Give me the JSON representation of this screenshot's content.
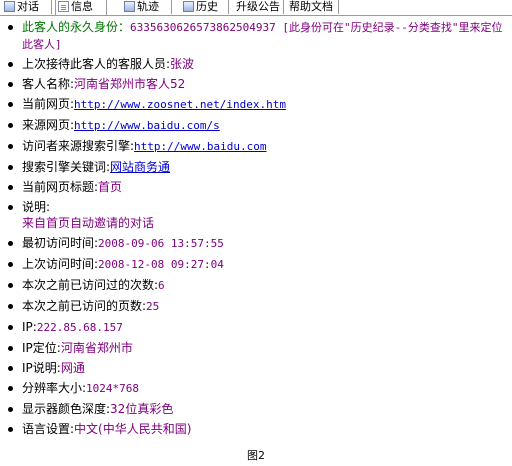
{
  "tabs": [
    {
      "label": "对话",
      "icon": "chat-icon"
    },
    {
      "label": "信息",
      "icon": "info-icon"
    },
    {
      "label": "轨迹",
      "icon": "track-icon"
    },
    {
      "label": "历史",
      "icon": "history-icon"
    },
    {
      "label": "升级公告",
      "icon": ""
    },
    {
      "label": "帮助文档",
      "icon": ""
    }
  ],
  "info": {
    "identity_label": "此客人的永久身份：",
    "identity_value": "633563062657386250493​7 [此身份可在\"历史纪录--分类查找\"里来定位此客人]",
    "last_agent_label": "上次接待此客人的客服人员:",
    "last_agent_value": "张波",
    "guest_name_label": "客人名称:",
    "guest_name_value": "河南省郑州市客人52",
    "current_page_label": "当前网页:",
    "current_page_value": "http://www.zoosnet.net/index.htm",
    "source_page_label": "来源网页:",
    "source_page_value": "http://www.baidu.com/s",
    "search_engine_label": "访问者来源搜索引擎:",
    "search_engine_value": "http://www.baidu.com",
    "keyword_label": "搜索引擎关键词:",
    "keyword_value": "网站商务通",
    "page_title_label": "当前网页标题:",
    "page_title_value": "首页",
    "note_label": "说明:",
    "note_value": "来自首页自动邀请的对话",
    "first_visit_label": "最初访问时间:",
    "first_visit_value": "2008-09-06 13:57:55",
    "last_visit_label": "上次访问时间:",
    "last_visit_value": "2008-12-08 09:27:04",
    "visit_count_label": "本次之前已访问过的次数:",
    "visit_count_value": "6",
    "page_count_label": "本次之前已访问的页数:",
    "page_count_value": "25",
    "ip_label": "IP:",
    "ip_value": "222.85.68.157",
    "ip_location_label": "IP定位:",
    "ip_location_value": "河南省郑州市",
    "ip_note_label": "IP说明:",
    "ip_note_value": "网通",
    "resolution_label": "分辨率大小:",
    "resolution_value": "1024*768",
    "color_depth_label": "显示器颜色深度:",
    "color_depth_value": "32位真彩色",
    "language_label": "语言设置:",
    "language_value": "中文(中华人民共和国)"
  },
  "caption": "图2"
}
